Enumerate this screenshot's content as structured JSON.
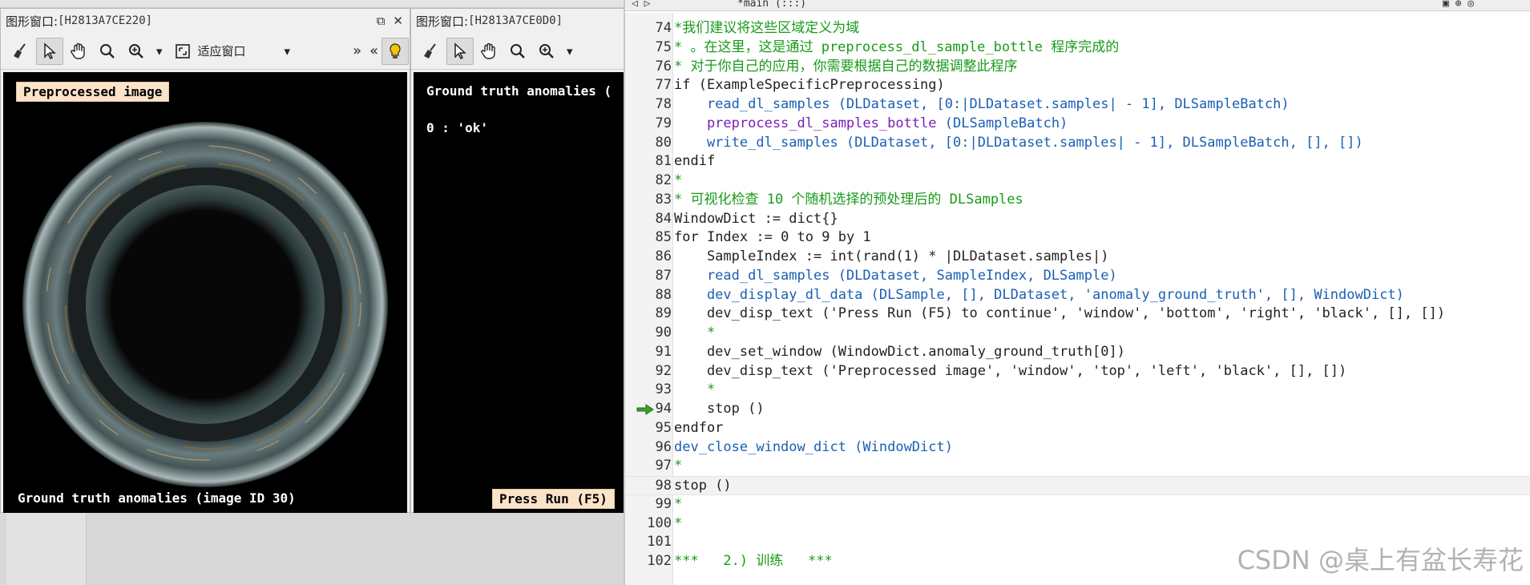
{
  "left_window": {
    "title_prefix": "图形窗口:",
    "title_id": "[H2813A7CE220]",
    "restore_glyph": "⧉",
    "close_glyph": "✕",
    "fit_window_label": "适应窗口",
    "dropdown_glyph": "▾",
    "more_glyph": "»",
    "collapse_glyph": "«",
    "top_label": "Preprocessed image",
    "bottom_text": "Ground truth anomalies (image ID 30)"
  },
  "right_window": {
    "title_prefix": "图形窗口:",
    "title_id": "[H2813A7CE0D0]",
    "heading": "Ground truth anomalies (",
    "class_line": "0 : 'ok'",
    "bottom_label": "Press Run (F5)"
  },
  "editor": {
    "procedure_name": "*main (:::)",
    "watermark": "CSDN @桌上有盆长寿花",
    "lines": [
      {
        "n": "74",
        "parts": [
          {
            "c": "comment",
            "t": "*我们建议将这些区域定义为域"
          }
        ]
      },
      {
        "n": "75",
        "parts": [
          {
            "c": "comment",
            "t": "* 。在这里，这是通过 preprocess_dl_sample_bottle 程序完成的"
          }
        ]
      },
      {
        "n": "76",
        "parts": [
          {
            "c": "comment",
            "t": "* 对于你自己的应用，你需要根据自己的数据调整此程序"
          }
        ]
      },
      {
        "n": "77",
        "parts": [
          {
            "c": "kw",
            "t": "if "
          },
          {
            "c": "plain",
            "t": "(ExampleSpecificPreprocessing)"
          }
        ]
      },
      {
        "n": "78",
        "parts": [
          {
            "c": "op",
            "t": "    read_dl_samples (DLDataset, [0:|DLDataset.samples| - 1], DLSampleBatch)"
          }
        ]
      },
      {
        "n": "79",
        "parts": [
          {
            "c": "purple",
            "t": "    preprocess_dl_samples_bottle "
          },
          {
            "c": "op",
            "t": "(DLSampleBatch)"
          }
        ]
      },
      {
        "n": "80",
        "parts": [
          {
            "c": "op",
            "t": "    write_dl_samples (DLDataset, [0:|DLDataset.samples| - 1], DLSampleBatch, [], [])"
          }
        ]
      },
      {
        "n": "81",
        "parts": [
          {
            "c": "kw",
            "t": "endif"
          }
        ]
      },
      {
        "n": "82",
        "parts": [
          {
            "c": "comment",
            "t": "*"
          }
        ]
      },
      {
        "n": "83",
        "parts": [
          {
            "c": "comment",
            "t": "* 可视化检查 10 个随机选择的预处理后的 DLSamples"
          }
        ]
      },
      {
        "n": "84",
        "parts": [
          {
            "c": "plain",
            "t": "WindowDict := dict{}"
          }
        ]
      },
      {
        "n": "85",
        "parts": [
          {
            "c": "kw",
            "t": "for "
          },
          {
            "c": "plain",
            "t": "Index := 0 to 9 by 1"
          }
        ]
      },
      {
        "n": "86",
        "parts": [
          {
            "c": "plain",
            "t": "    SampleIndex := int(rand(1) * |DLDataset.samples|)"
          }
        ]
      },
      {
        "n": "87",
        "parts": [
          {
            "c": "op",
            "t": "    read_dl_samples (DLDataset, SampleIndex, DLSample)"
          }
        ]
      },
      {
        "n": "88",
        "parts": [
          {
            "c": "op",
            "t": "    dev_display_dl_data (DLSample, [], DLDataset, 'anomaly_ground_truth', [], WindowDict)"
          }
        ]
      },
      {
        "n": "89",
        "parts": [
          {
            "c": "plain",
            "t": "    dev_disp_text ('Press Run (F5) to continue', 'window', 'bottom', 'right', 'black', [], [])"
          }
        ]
      },
      {
        "n": "90",
        "parts": [
          {
            "c": "comment",
            "t": "    *"
          }
        ]
      },
      {
        "n": "91",
        "parts": [
          {
            "c": "plain",
            "t": "    dev_set_window (WindowDict.anomaly_ground_truth[0])"
          }
        ]
      },
      {
        "n": "92",
        "parts": [
          {
            "c": "plain",
            "t": "    dev_disp_text ('Preprocessed image', 'window', 'top', 'left', 'black', [], [])"
          }
        ]
      },
      {
        "n": "93",
        "parts": [
          {
            "c": "comment",
            "t": "    *"
          }
        ]
      },
      {
        "n": "94",
        "parts": [
          {
            "c": "plain",
            "t": "    stop ()"
          }
        ],
        "marker": true
      },
      {
        "n": "95",
        "parts": [
          {
            "c": "kw",
            "t": "endfor"
          }
        ]
      },
      {
        "n": "96",
        "parts": [
          {
            "c": "op",
            "t": "dev_close_window_dict (WindowDict)"
          }
        ]
      },
      {
        "n": "97",
        "parts": [
          {
            "c": "comment",
            "t": "*"
          }
        ]
      },
      {
        "n": "98",
        "parts": [
          {
            "c": "plain",
            "t": "stop ()"
          }
        ],
        "current": true
      },
      {
        "n": "99",
        "parts": [
          {
            "c": "comment",
            "t": "*"
          }
        ]
      },
      {
        "n": "100",
        "parts": [
          {
            "c": "comment",
            "t": "*"
          }
        ]
      },
      {
        "n": "101",
        "parts": [
          {
            "c": "plain",
            "t": ""
          }
        ]
      },
      {
        "n": "102",
        "parts": [
          {
            "c": "comment",
            "t": "***   2.) 训练   ***"
          }
        ]
      }
    ]
  }
}
